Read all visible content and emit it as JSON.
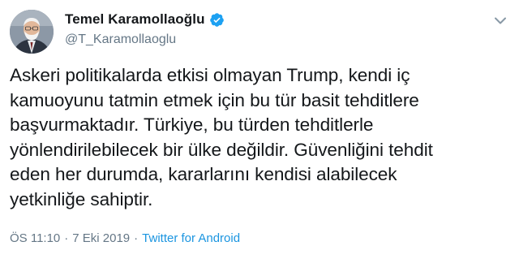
{
  "tweet": {
    "author": {
      "display_name": "Temel Karamollaoğlu",
      "handle": "@T_Karamollaoglu",
      "verified": true,
      "avatar_icon": "avatar-portrait"
    },
    "text_lines": [
      "Askeri politikalarda etkisi olmayan Trump, kendi iç",
      "kamuoyunu tatmin etmek için bu tür basit tehditlere",
      "başvurmaktadır. Türkiye, bu türden tehditlerle",
      "yönlendirilebilecek bir ülke değildir. Güvenliğini tehdit",
      "eden her durumda, kararlarını kendisi alabilecek",
      "yetkinliğe sahiptir."
    ],
    "time": "ÖS 11:10",
    "date": "7 Eki 2019",
    "separator": "·",
    "source": "Twitter for Android",
    "menu_icon": "chevron-down-icon",
    "verified_icon": "verified-badge-icon"
  },
  "colors": {
    "text": "#14171a",
    "secondary": "#657786",
    "link": "#1b95e0",
    "verified": "#1da1f2"
  }
}
